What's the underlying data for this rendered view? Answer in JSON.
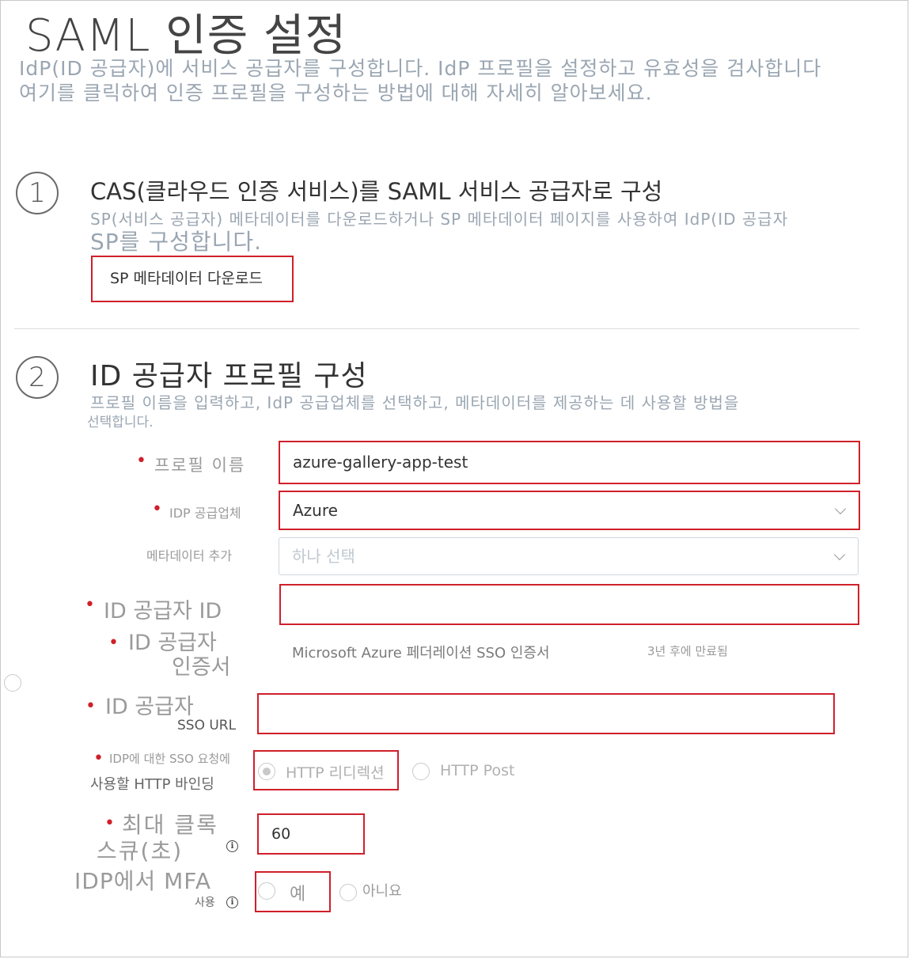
{
  "page": {
    "title": "SAML 인증 설정",
    "subtitle_line1": "IdP(ID 공급자)에 서비스 공급자를 구성합니다. IdP 프로필을 설정하고 유효성을 검사합니다",
    "subtitle_line2": "여기를 클릭하여 인증 프로필을 구성하는 방법에 대해 자세히 알아보세요."
  },
  "step1": {
    "number": "1",
    "heading": "CAS(클라우드 인증 서비스)를 SAML 서비스 공급자로 구성",
    "desc_line1": "SP(서비스 공급자) 메타데이터를 다운로드하거나 SP 메타데이터 페이지를 사용하여 IdP(ID 공급자",
    "desc_line2": "SP를 구성합니다.",
    "download_label": "SP 메타데이터 다운로드"
  },
  "step2": {
    "number": "2",
    "heading": "ID 공급자 프로필 구성",
    "desc_line1": "프로필 이름을 입력하고, IdP 공급업체를 선택하고, 메타데이터를 제공하는 데 사용할 방법을",
    "desc_line2": "선택합니다.",
    "profile_name": {
      "label": "프로필 이름",
      "value": "azure-gallery-app-test"
    },
    "idp_vendor": {
      "label": "IDP 공급업체",
      "value": "Azure"
    },
    "add_metadata": {
      "label": "메타데이터 추가",
      "placeholder": "하나 선택"
    },
    "idp_id": {
      "label": "ID 공급자 ID",
      "value": ""
    },
    "idp_cert": {
      "label_line1": "ID 공급자",
      "label_line2": "인증서",
      "cert_name": "Microsoft Azure 페더레이션 SSO 인증서",
      "expiry": "3년 후에 만료됨"
    },
    "sso_url": {
      "label_line1": "ID 공급자",
      "label_line2": "SSO URL",
      "value": ""
    },
    "binding": {
      "label_line1": "IDP에 대한 SSO 요청에",
      "label_line2": "사용할 HTTP 바인딩",
      "option1": "HTTP 리디렉션",
      "option2": "HTTP Post",
      "selected": "HTTP 리디렉션"
    },
    "clock_skew": {
      "label_line1": "최대 클록",
      "label_line2": "스큐(초)",
      "value": "60"
    },
    "mfa": {
      "label_line1": "IDP에서 MFA",
      "label_line2": "사용",
      "option_yes": "예",
      "option_no": "아니요"
    }
  },
  "icons": {
    "required": "required-dot-icon",
    "info": "info-icon",
    "dropdown": "chevron-down-icon"
  },
  "colors": {
    "required": "#d0202a",
    "highlight": "#d0202a",
    "muted": "#9aa6b2"
  }
}
